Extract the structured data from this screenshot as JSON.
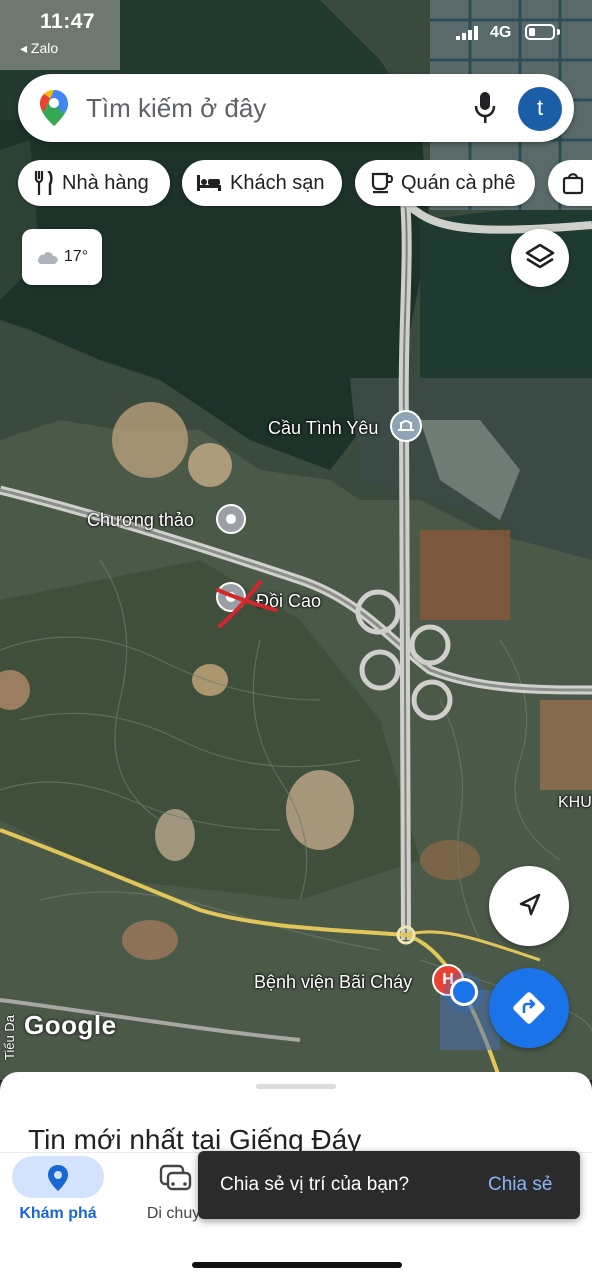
{
  "status_bar": {
    "time": "11:47",
    "back_app": "◂ Zalo",
    "network": "4G"
  },
  "search": {
    "placeholder": "Tìm kiếm ở đây",
    "avatar_letter": "t"
  },
  "chips": [
    {
      "label": "Nhà hàng",
      "icon": "restaurant-icon"
    },
    {
      "label": "Khách sạn",
      "icon": "hotel-icon"
    },
    {
      "label": "Quán cà phê",
      "icon": "coffee-icon"
    }
  ],
  "weather": {
    "temperature": "17°",
    "icon": "cloud-icon"
  },
  "map_labels": {
    "bridge": "Cầu Tình Yêu",
    "chuong_thao": "Chương thảo",
    "doi_cao": "Đồi Cao",
    "hospital": "Bệnh viện Bãi Cháy",
    "khu": "KHU",
    "road_side": "Tiểu Da"
  },
  "google_logo": "Google",
  "sheet": {
    "title": "Tin mới nhất tại Giếng Đáy"
  },
  "tabs": [
    {
      "label": "Khám phá",
      "active": true,
      "icon": "explore-pin-icon"
    },
    {
      "label": "Di chuyể",
      "active": false,
      "icon": "commute-icon"
    }
  ],
  "toast": {
    "message": "Chia sẻ vị trí của bạn?",
    "action": "Chia sẻ"
  },
  "colors": {
    "accent": "#1a73e8",
    "active_tab": "#1967d2",
    "active_pill": "#d3e3fd",
    "hospital": "#e94235"
  }
}
